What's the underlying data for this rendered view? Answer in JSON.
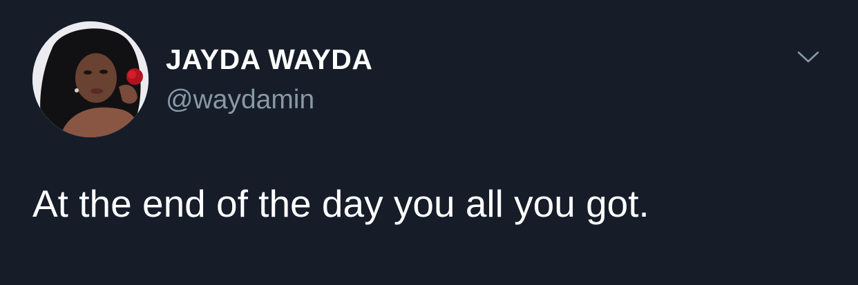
{
  "tweet": {
    "author": {
      "display_name": "JAYDA WAYDA",
      "handle": "@waydamin"
    },
    "text": "At the end of the day you all you got."
  },
  "icons": {
    "avatar": "profile-photo",
    "menu": "chevron-down-icon"
  },
  "colors": {
    "background": "#161d29",
    "name": "#ffffff",
    "handle": "#8899a6",
    "body_text": "#ffffff",
    "chevron": "#8899a6"
  }
}
